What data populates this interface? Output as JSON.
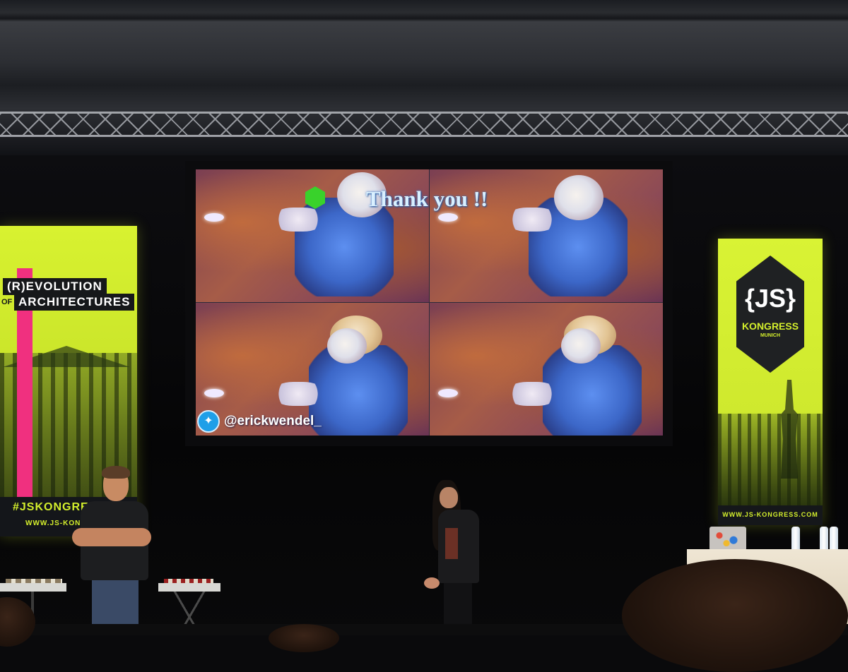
{
  "slide": {
    "title": "Thank you !!",
    "twitter_handle": "@erickwendel_",
    "twitter_icon_glyph": "✦"
  },
  "left_banner": {
    "line1": "(R)EVOLUTION",
    "line2_prefix": "OF",
    "line2": "ARCHITECTURES",
    "hashtag": "#JSKONGRESS",
    "url": "WWW.JS-KONGRESS"
  },
  "right_banner": {
    "logo_main": "{JS}",
    "logo_sub": "KONGRESS",
    "logo_city": "MUNICH",
    "url": "WWW.JS-KONGRESS.COM"
  },
  "colors": {
    "banner_yellow": "#d4ef2c",
    "banner_pink": "#f0307f",
    "node_green": "#39d22b",
    "twitter_blue": "#1f9fe8"
  }
}
